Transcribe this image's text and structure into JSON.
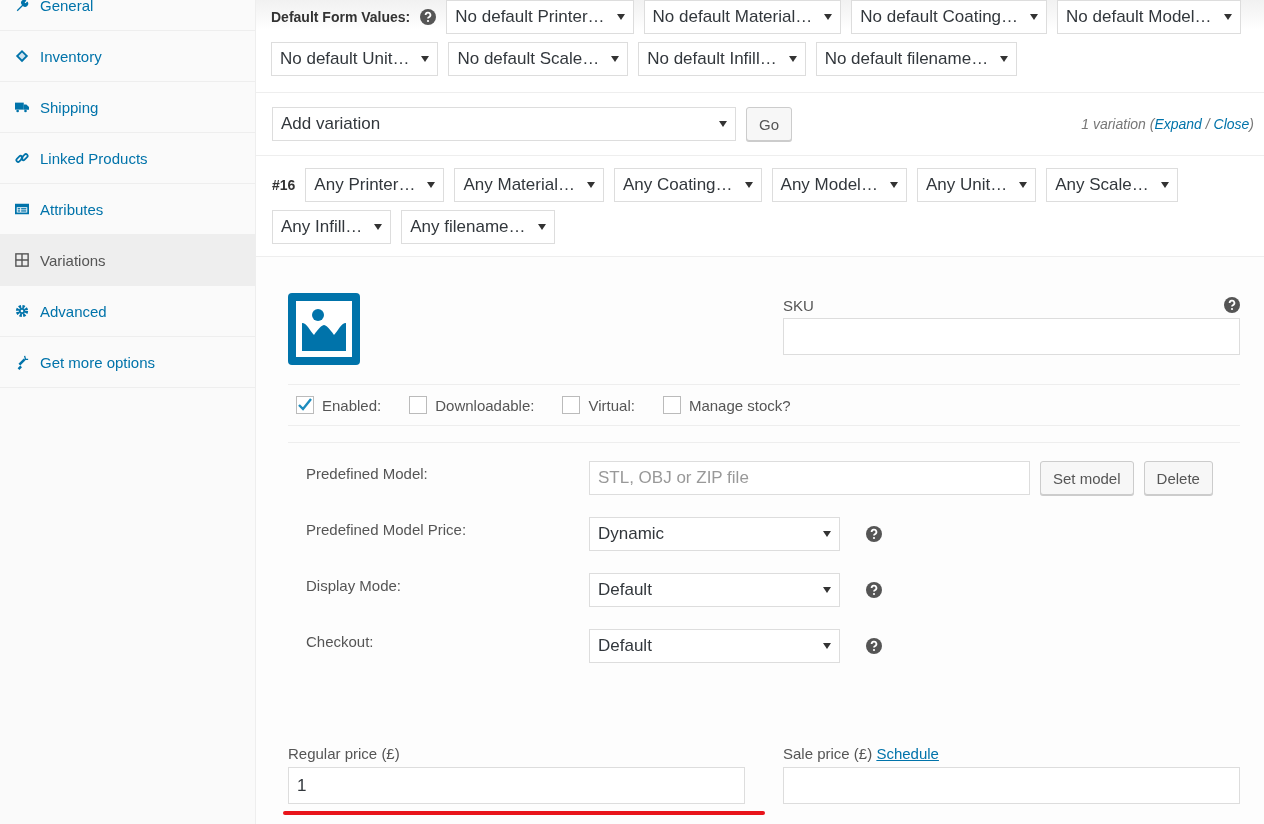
{
  "sidebar": {
    "items": [
      {
        "label": "General",
        "selected": false
      },
      {
        "label": "Inventory",
        "selected": false
      },
      {
        "label": "Shipping",
        "selected": false
      },
      {
        "label": "Linked Products",
        "selected": false
      },
      {
        "label": "Attributes",
        "selected": false
      },
      {
        "label": "Variations",
        "selected": true
      },
      {
        "label": "Advanced",
        "selected": false
      },
      {
        "label": "Get more options",
        "selected": false
      }
    ]
  },
  "default_form_values": {
    "label": "Default Form Values:",
    "selects": [
      "No default Printer…",
      "No default Material…",
      "No default Coating…",
      "No default Model…",
      "No default Unit…",
      "No default Scale…",
      "No default Infill…",
      "No default filename…"
    ]
  },
  "add_variation": {
    "select": "Add variation",
    "button": "Go",
    "summary": "1 variation (",
    "expand": "Expand",
    "separator": " / ",
    "close": "Close",
    "summary_end": ")"
  },
  "variation": {
    "number": "#16",
    "attributes": [
      "Any Printer…",
      "Any Material…",
      "Any Coating…",
      "Any Model…",
      "Any Unit…",
      "Any Scale…",
      "Any Infill…",
      "Any filename…"
    ],
    "sku_label": "SKU",
    "options": [
      {
        "label": "Enabled:",
        "checked": true
      },
      {
        "label": "Downloadable:",
        "checked": false
      },
      {
        "label": "Virtual:",
        "checked": false
      },
      {
        "label": "Manage stock?",
        "checked": false
      }
    ],
    "predefined_model": {
      "label": "Predefined Model:",
      "placeholder": "STL, OBJ or ZIP file",
      "buttons": [
        "Set model",
        "Delete"
      ]
    },
    "settings": [
      {
        "label": "Predefined Model Price:",
        "value": "Dynamic"
      },
      {
        "label": "Display Mode:",
        "value": "Default"
      },
      {
        "label": "Checkout:",
        "value": "Default"
      }
    ],
    "regular_price": {
      "label": "Regular price (£)",
      "value": "1"
    },
    "sale_price": {
      "label": "Sale price (£)",
      "link": "Schedule"
    }
  }
}
